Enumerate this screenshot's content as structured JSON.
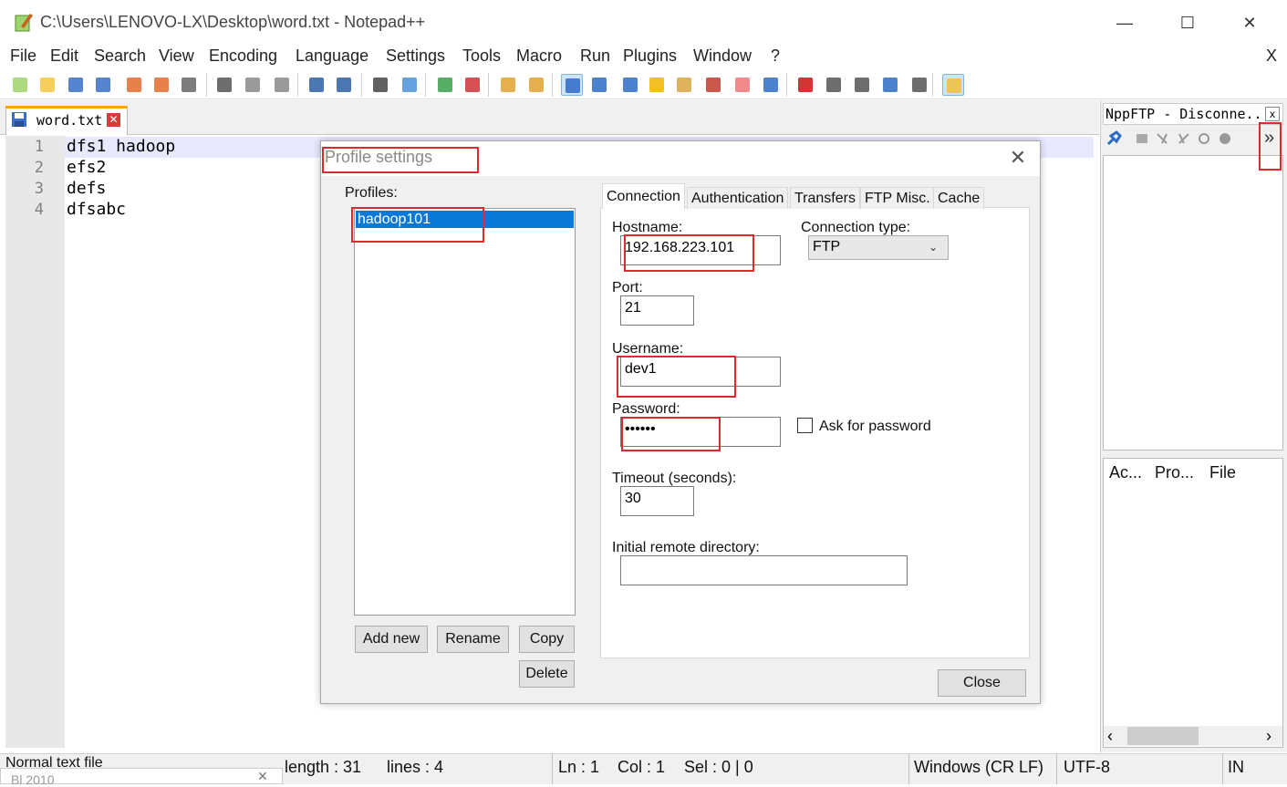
{
  "window": {
    "title": "C:\\Users\\LENOVO-LX\\Desktop\\word.txt - Notepad++",
    "minimize": "—",
    "maximize": "☐",
    "close": "✕"
  },
  "menu": [
    "File",
    "Edit",
    "Search",
    "View",
    "Encoding",
    "Language",
    "Settings",
    "Tools",
    "Macro",
    "Run",
    "Plugins",
    "Window",
    "?"
  ],
  "menu_close": "X",
  "toolbar_icons": [
    "new-file-icon",
    "open-file-icon",
    "save-icon",
    "save-all-icon",
    "close-icon",
    "close-all-icon",
    "print-icon",
    "cut-icon",
    "copy-icon",
    "paste-icon",
    "undo-icon",
    "redo-icon",
    "find-icon",
    "replace-icon",
    "zoom-in-icon",
    "zoom-out-icon",
    "sync-vertical-icon",
    "sync-horizontal-icon",
    "word-wrap-icon",
    "show-all-chars-icon",
    "indent-guide-icon",
    "user-language-icon",
    "doc-map-icon",
    "function-list-icon",
    "folder-workspace-icon",
    "monitoring-icon",
    "record-macro-icon",
    "stop-macro-icon",
    "play-macro-icon",
    "run-macro-multiple-icon",
    "save-macro-icon",
    "nppftp-icon"
  ],
  "tab": {
    "label": "word.txt",
    "close": "✕"
  },
  "editor": {
    "lines": [
      {
        "num": "1",
        "text": "dfs1 hadoop"
      },
      {
        "num": "2",
        "text": "efs2"
      },
      {
        "num": "3",
        "text": "defs"
      },
      {
        "num": "4",
        "text": "dfsabc"
      }
    ]
  },
  "nppftp": {
    "title": "NppFTP - Disconne...",
    "close": "x",
    "expand": "»",
    "queue_columns": [
      "Ac...",
      "Pro...",
      "File"
    ],
    "scroll_left": "‹",
    "scroll_right": "›"
  },
  "statusbar": {
    "file_type": "Normal text file",
    "length": "length : 31",
    "lines": "lines : 4",
    "ln": "Ln : 1",
    "col": "Col : 1",
    "sel": "Sel : 0 | 0",
    "eol": "Windows (CR LF)",
    "encoding": "UTF-8",
    "ins": "IN",
    "bottom_fragment": "Bl    2010"
  },
  "dialog": {
    "title": "Profile settings",
    "close": "✕",
    "profiles_label": "Profiles:",
    "profiles": [
      "hadoop101"
    ],
    "buttons": {
      "add_new": "Add new",
      "rename": "Rename",
      "copy": "Copy",
      "delete": "Delete",
      "close": "Close"
    },
    "tabs": [
      "Connection",
      "Authentication",
      "Transfers",
      "FTP Misc.",
      "Cache"
    ],
    "active_tab": "Connection",
    "hostname_label": "Hostname:",
    "hostname_value": "192.168.223.101",
    "connection_type_label": "Connection type:",
    "connection_type_value": "FTP",
    "port_label": "Port:",
    "port_value": "21",
    "username_label": "Username:",
    "username_value": "dev1",
    "password_label": "Password:",
    "password_value": "••••••",
    "ask_password_label": "Ask for password",
    "ask_password_checked": false,
    "timeout_label": "Timeout (seconds):",
    "timeout_value": "30",
    "initial_dir_label": "Initial remote directory:",
    "initial_dir_value": ""
  },
  "colors": {
    "highlight": "#e0282e",
    "selection": "#0a78d7",
    "tab_accent": "#f2a900"
  }
}
